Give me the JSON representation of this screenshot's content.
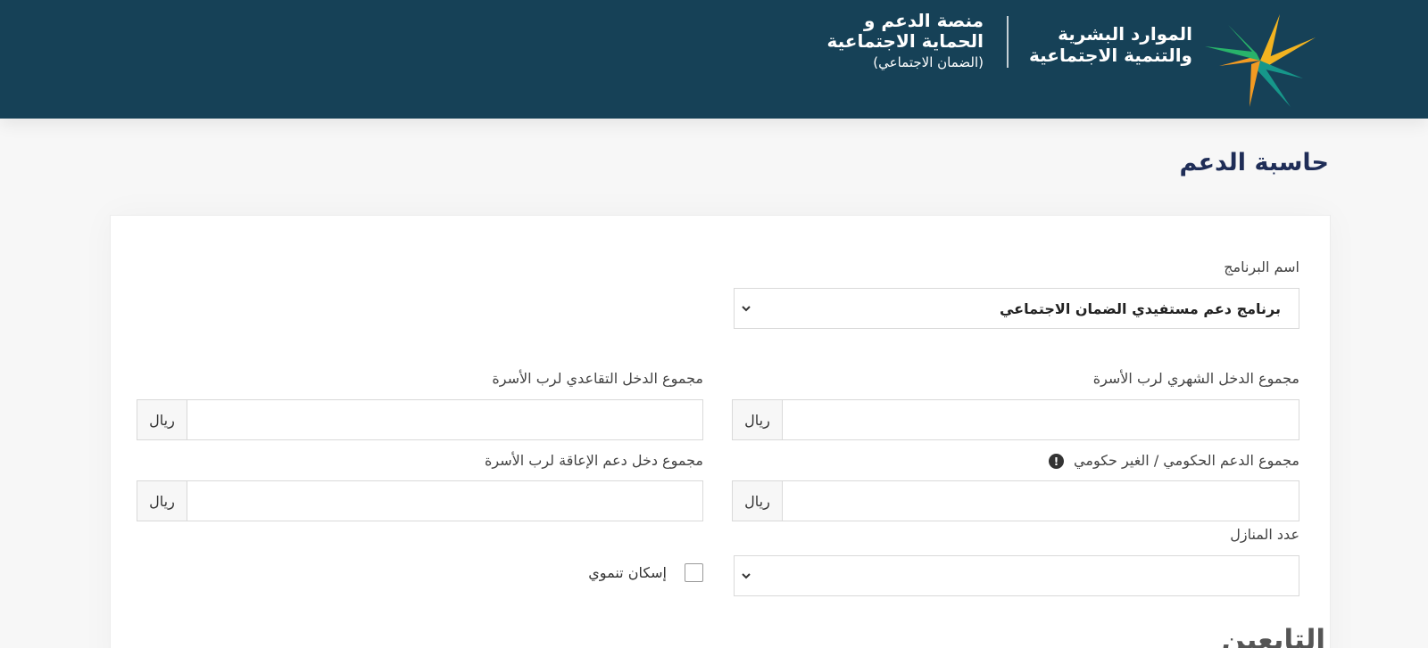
{
  "header": {
    "ministry_line1": "الموارد البشرية",
    "ministry_line2": "والتنمية الاجتماعية",
    "platform_line1": "منصة الدعم و",
    "platform_line2": "الحماية الاجتماعية",
    "platform_sub": "(الضمان الاجتماعي)",
    "logo_icon": "ministry-logo-icon",
    "background_color": "#164157"
  },
  "page": {
    "title": "حاسبة الدعم"
  },
  "form": {
    "program": {
      "label": "اسم البرنامج",
      "value": "برنامج دعم مستفيدي الضمان الاجتماعي"
    },
    "monthly_income": {
      "label": "مجموع الدخل الشهري لرب الأسرة",
      "currency": "ريال",
      "value": ""
    },
    "retirement_income": {
      "label": "مجموع الدخل التقاعدي لرب الأسرة",
      "currency": "ريال",
      "value": ""
    },
    "gov_support": {
      "label": "مجموع الدعم الحكومي / الغير حكومي",
      "currency": "ريال",
      "info_icon": "info-icon",
      "value": ""
    },
    "disability_income": {
      "label": "مجموع دخل دعم الإعاقة لرب الأسرة",
      "currency": "ريال",
      "value": ""
    },
    "houses_count": {
      "label": "عدد المنازل",
      "value": ""
    },
    "development_housing": {
      "label": "إسكان تنموي",
      "checked": false
    }
  },
  "section": {
    "dependents_heading": "التابعين"
  }
}
